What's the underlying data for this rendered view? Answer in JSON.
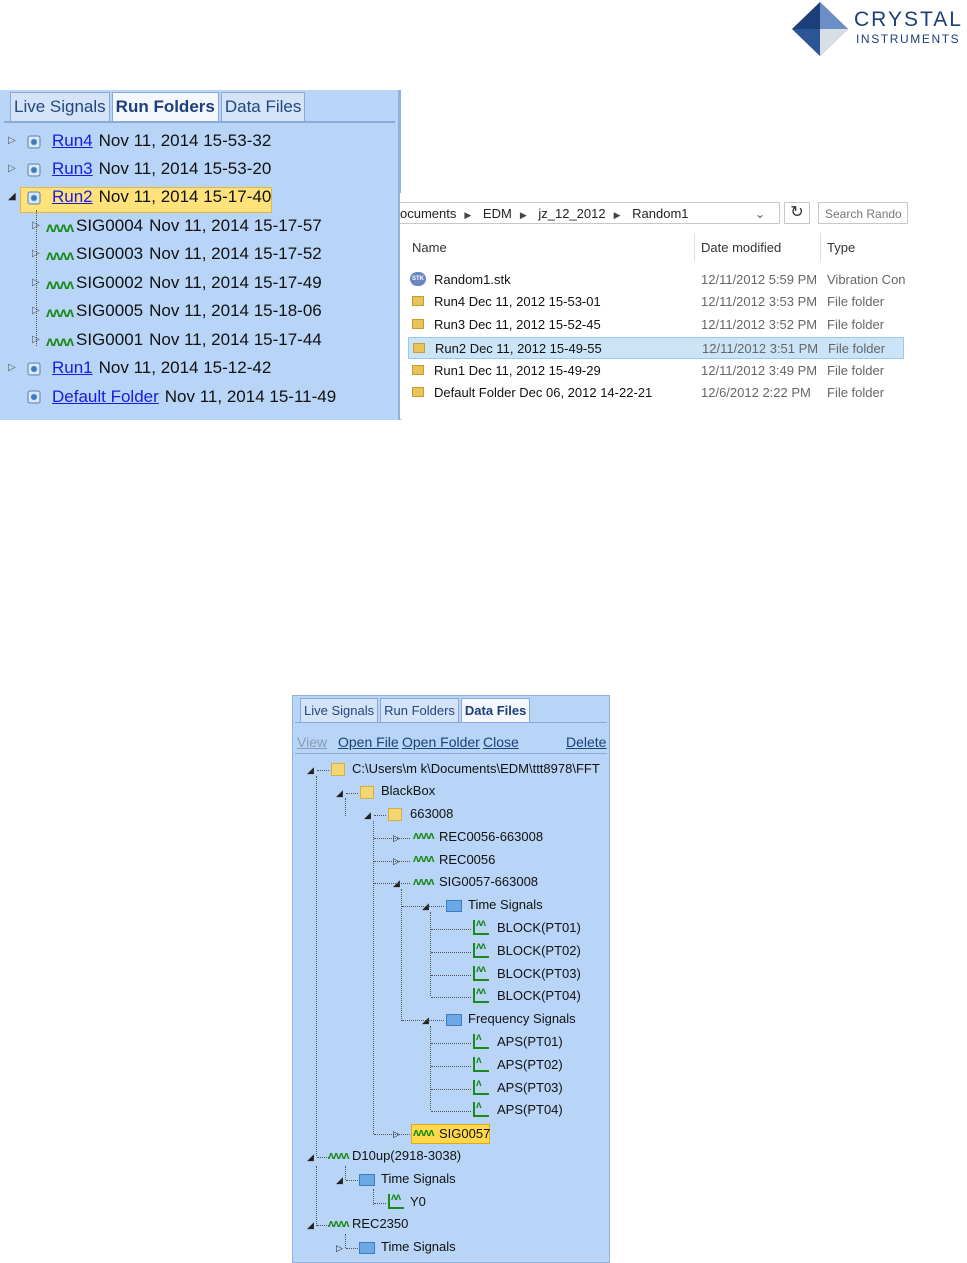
{
  "logo": {
    "line1": "CRYSTAL",
    "line2": "INSTRUMENTS"
  },
  "panel1": {
    "tabs": [
      "Live Signals",
      "Run Folders",
      "Data Files"
    ],
    "active_tab": "Run Folders",
    "items": [
      {
        "name": "Run4",
        "date": "Nov 11, 2014 15-53-32"
      },
      {
        "name": "Run3",
        "date": "Nov 11, 2014 15-53-20"
      },
      {
        "name": "Run2",
        "date": "Nov 11, 2014 15-17-40"
      },
      {
        "name": "SIG0004",
        "date": "Nov 11, 2014 15-17-57"
      },
      {
        "name": "SIG0003",
        "date": "Nov 11, 2014 15-17-52"
      },
      {
        "name": "SIG0002",
        "date": "Nov 11, 2014 15-17-49"
      },
      {
        "name": "SIG0005",
        "date": "Nov 11, 2014 15-18-06"
      },
      {
        "name": "SIG0001",
        "date": "Nov 11, 2014 15-17-44"
      },
      {
        "name": "Run1",
        "date": "Nov 11, 2014 15-12-42"
      },
      {
        "name": "Default Folder",
        "date": "Nov 11, 2014 15-11-49"
      }
    ]
  },
  "explorer": {
    "breadcrumb": [
      "ocuments",
      "EDM",
      "jz_12_2012",
      "Random1"
    ],
    "search_placeholder": "Search Rando",
    "columns": [
      "Name",
      "Date modified",
      "Type"
    ],
    "files": [
      {
        "name": "Random1.stk",
        "date": "12/11/2012 5:59 PM",
        "type": "Vibration Con"
      },
      {
        "name": "Run4 Dec 11, 2012 15-53-01",
        "date": "12/11/2012 3:53 PM",
        "type": "File folder"
      },
      {
        "name": "Run3 Dec 11, 2012 15-52-45",
        "date": "12/11/2012 3:52 PM",
        "type": "File folder"
      },
      {
        "name": "Run2 Dec 11, 2012 15-49-55",
        "date": "12/11/2012 3:51 PM",
        "type": "File folder"
      },
      {
        "name": "Run1 Dec 11, 2012 15-49-29",
        "date": "12/11/2012 3:49 PM",
        "type": "File folder"
      },
      {
        "name": "Default Folder Dec 06, 2012 14-22-21",
        "date": "12/6/2012 2:22 PM",
        "type": "File folder"
      }
    ]
  },
  "panel2": {
    "tabs": [
      "Live Signals",
      "Run Folders",
      "Data Files"
    ],
    "active_tab": "Data Files",
    "toolbar": {
      "view": "View",
      "open_file": "Open File",
      "open_folder": "Open Folder",
      "close": "Close",
      "delete": "Delete"
    },
    "tree": [
      "C:\\Users\\m k\\Documents\\EDM\\ttt8978\\FFT",
      "BlackBox",
      "663008",
      "REC0056-663008",
      "REC0056",
      "SIG0057-663008",
      "Time Signals",
      "BLOCK(PT01)",
      "BLOCK(PT02)",
      "BLOCK(PT03)",
      "BLOCK(PT04)",
      "Frequency Signals",
      "APS(PT01)",
      "APS(PT02)",
      "APS(PT03)",
      "APS(PT04)",
      "SIG0057",
      "D10up(2918-3038)",
      "Time Signals",
      "Y0",
      "REC2350",
      "Time Signals"
    ]
  }
}
